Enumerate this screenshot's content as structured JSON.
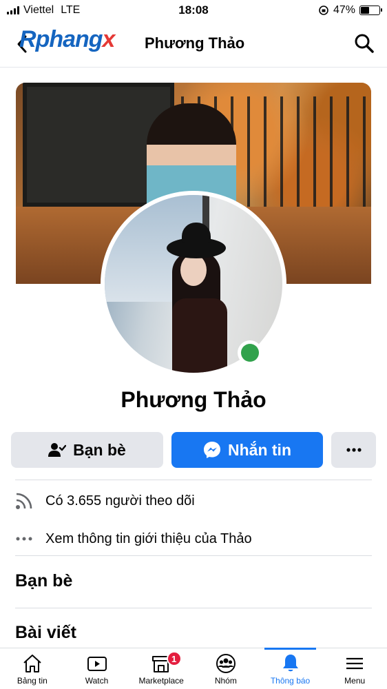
{
  "status_bar": {
    "carrier": "Viettel",
    "network": "LTE",
    "time": "18:08",
    "battery": "47%",
    "battery_level": 0.47
  },
  "header": {
    "logo_text": [
      "R",
      "phang",
      "x"
    ],
    "title": "Phương Thảo"
  },
  "profile": {
    "name": "Phương Thảo",
    "online": true
  },
  "actions": {
    "friends_label": "Bạn bè",
    "message_label": "Nhắn tin"
  },
  "info": {
    "followers_text": "Có 3.655 người theo dõi",
    "about_text": "Xem thông tin giới thiệu của Thảo"
  },
  "sections": {
    "friends_title": "Bạn bè",
    "posts_title": "Bài viết"
  },
  "tabbar": {
    "items": [
      {
        "label": "Bảng tin",
        "icon": "home-icon"
      },
      {
        "label": "Watch",
        "icon": "watch-icon"
      },
      {
        "label": "Marketplace",
        "icon": "marketplace-icon",
        "badge": "1"
      },
      {
        "label": "Nhóm",
        "icon": "groups-icon"
      },
      {
        "label": "Thông báo",
        "icon": "bell-icon",
        "active": true
      },
      {
        "label": "Menu",
        "icon": "menu-icon"
      }
    ]
  },
  "colors": {
    "accent": "#1877f2",
    "online": "#31a24c",
    "badge": "#e41e3f",
    "button_gray": "#e4e6eb"
  }
}
